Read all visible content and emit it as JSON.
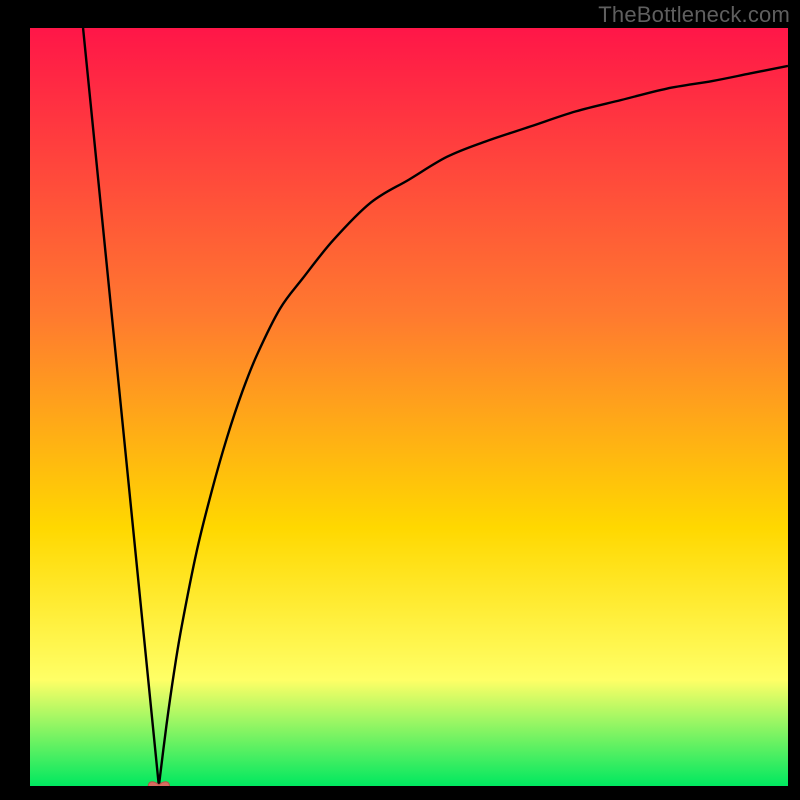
{
  "watermark": "TheBottleneck.com",
  "colors": {
    "gradient_top": "#ff1648",
    "gradient_mid1": "#ff7a2f",
    "gradient_mid2": "#ffd800",
    "gradient_mid3": "#ffff66",
    "gradient_bottom": "#00e860",
    "curve": "#000000",
    "marker": "#d86b60",
    "border": "#000000"
  },
  "chart_data": {
    "type": "line",
    "title": "",
    "xlabel": "",
    "ylabel": "",
    "xlim": [
      0,
      100
    ],
    "ylim": [
      0,
      100
    ],
    "grid": false,
    "legend": false,
    "minimum": {
      "x": 17,
      "y": 0
    },
    "series": [
      {
        "name": "left-branch",
        "x": [
          7,
          8,
          9,
          10,
          11,
          12,
          13,
          14,
          15,
          16,
          17
        ],
        "values": [
          100,
          90,
          80,
          70,
          60,
          50,
          40,
          30,
          20,
          10,
          0
        ]
      },
      {
        "name": "right-branch",
        "x": [
          17,
          18,
          19,
          20,
          22,
          24,
          26,
          28,
          30,
          33,
          36,
          40,
          45,
          50,
          55,
          60,
          66,
          72,
          78,
          84,
          90,
          95,
          100
        ],
        "values": [
          0,
          8,
          15,
          21,
          31,
          39,
          46,
          52,
          57,
          63,
          67,
          72,
          77,
          80,
          83,
          85,
          87,
          89,
          90.5,
          92,
          93,
          94,
          95
        ]
      }
    ]
  }
}
